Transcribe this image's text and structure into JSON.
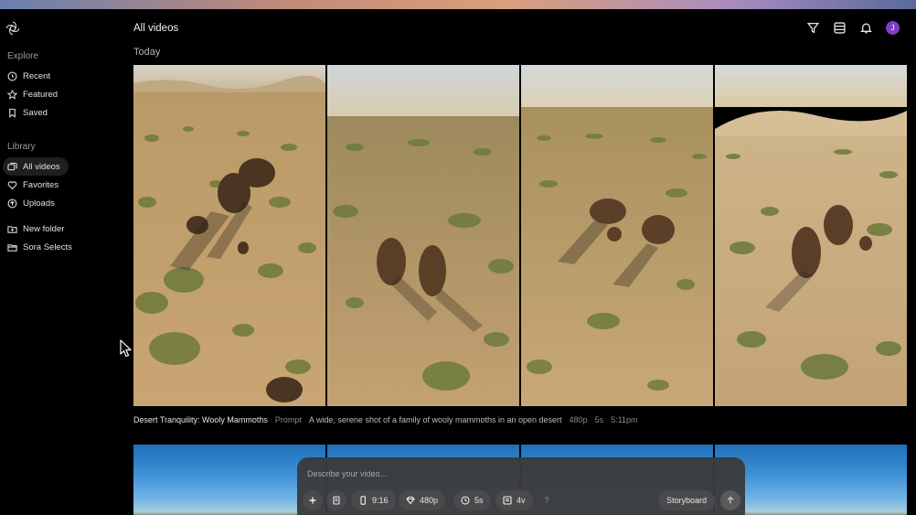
{
  "sidebar": {
    "explore_label": "Explore",
    "explore_items": [
      {
        "label": "Recent",
        "icon": "clock-icon"
      },
      {
        "label": "Featured",
        "icon": "star-icon"
      },
      {
        "label": "Saved",
        "icon": "bookmark-icon"
      }
    ],
    "library_label": "Library",
    "library_items": [
      {
        "label": "All videos",
        "icon": "videos-icon",
        "active": true
      },
      {
        "label": "Favorites",
        "icon": "heart-icon"
      },
      {
        "label": "Uploads",
        "icon": "upload-icon"
      }
    ],
    "folder_items": [
      {
        "label": "New folder",
        "icon": "new-folder-icon"
      },
      {
        "label": "Sora Selects",
        "icon": "folder-icon"
      }
    ]
  },
  "header": {
    "title": "All videos",
    "avatar_initial": "J",
    "icons": [
      "filter-icon",
      "grid-view-icon",
      "bell-icon"
    ]
  },
  "feed": {
    "group_label": "Today",
    "item": {
      "title": "Desert Tranquility: Wooly Mammoths",
      "prompt_label": "Prompt",
      "prompt": "A wide, serene shot of a family of wooly mammoths in an open desert",
      "resolution": "480p",
      "duration": "5s",
      "time": "5:11pm"
    }
  },
  "composer": {
    "placeholder": "Describe your video...",
    "aspect": "9:16",
    "resolution": "480p",
    "duration": "5s",
    "variations": "4v",
    "help": "?",
    "storyboard_label": "Storyboard"
  },
  "colors": {
    "accent_avatar": "#7b3fc4",
    "sand": "#c9a574",
    "sky": "#cfd8dc"
  }
}
